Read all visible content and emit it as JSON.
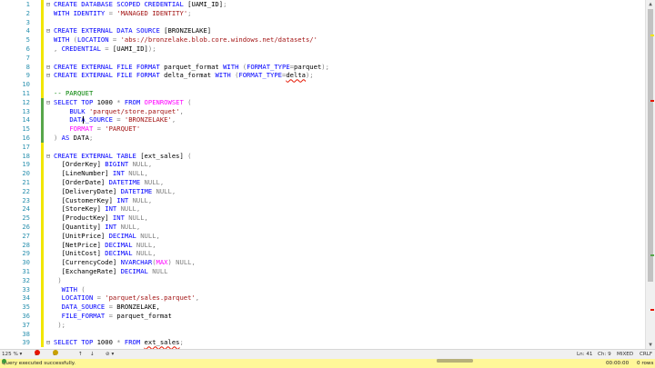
{
  "editor": {
    "lines": [
      {
        "num": "1",
        "tokens": [
          [
            "k",
            "CREATE DATABASE SCOPED CREDENTIAL "
          ],
          [
            "",
            "[UAMI_ID]"
          ],
          [
            "g",
            ";"
          ]
        ]
      },
      {
        "num": "2",
        "tokens": [
          [
            "k",
            "WITH IDENTITY "
          ],
          [
            "g",
            "= "
          ],
          [
            "s",
            "'MANAGED IDENTITY'"
          ],
          [
            "g",
            ";"
          ]
        ]
      },
      {
        "num": "3",
        "tokens": []
      },
      {
        "num": "4",
        "tokens": [
          [
            "k",
            "CREATE EXTERNAL DATA SOURCE "
          ],
          [
            "",
            "[BRONZELAKE]"
          ]
        ]
      },
      {
        "num": "5",
        "tokens": [
          [
            "k",
            "WITH "
          ],
          [
            "g",
            "("
          ],
          [
            "k",
            "LOCATION "
          ],
          [
            "g",
            "= "
          ],
          [
            "s",
            "'abs://bronzelake.blob.core.windows.net/datasets/'"
          ]
        ]
      },
      {
        "num": "6",
        "tokens": [
          [
            "g",
            ", "
          ],
          [
            "k",
            "CREDENTIAL "
          ],
          [
            "g",
            "= "
          ],
          [
            "",
            "[UAMI_ID]"
          ],
          [
            "g",
            ");"
          ]
        ]
      },
      {
        "num": "7",
        "tokens": []
      },
      {
        "num": "8",
        "tokens": [
          [
            "k",
            "CREATE EXTERNAL FILE FORMAT "
          ],
          [
            "",
            "parquet_format "
          ],
          [
            "k",
            "WITH "
          ],
          [
            "g",
            "("
          ],
          [
            "k",
            "FORMAT_TYPE"
          ],
          [
            "g",
            "="
          ],
          [
            "",
            "parquet"
          ],
          [
            "g",
            ");"
          ]
        ]
      },
      {
        "num": "9",
        "tokens": [
          [
            "k",
            "CREATE EXTERNAL FILE FORMAT "
          ],
          [
            "",
            "delta_format "
          ],
          [
            "k",
            "WITH "
          ],
          [
            "g",
            "("
          ],
          [
            "k",
            "FORMAT_TYPE"
          ],
          [
            "g",
            "="
          ],
          [
            "err",
            "delta"
          ],
          [
            "g",
            ");"
          ]
        ]
      },
      {
        "num": "10",
        "tokens": []
      },
      {
        "num": "11",
        "tokens": [
          [
            "c",
            "-- PARQUET"
          ]
        ]
      },
      {
        "num": "12",
        "tokens": [
          [
            "k",
            "SELECT TOP "
          ],
          [
            "",
            "1000 "
          ],
          [
            "g",
            "* "
          ],
          [
            "k",
            "FROM "
          ],
          [
            "f",
            "OPENROWSET "
          ],
          [
            "g",
            "("
          ]
        ]
      },
      {
        "num": "13",
        "tokens": [
          [
            "",
            "    "
          ],
          [
            "k",
            "BULK "
          ],
          [
            "s",
            "'parquet/store.parquet'"
          ],
          [
            "g",
            ","
          ]
        ]
      },
      {
        "num": "14",
        "tokens": [
          [
            "",
            "    "
          ],
          [
            "k",
            "DATA_SOURCE "
          ],
          [
            "g",
            "= "
          ],
          [
            "s",
            "'BRONZELAKE'"
          ],
          [
            "g",
            ","
          ]
        ]
      },
      {
        "num": "15",
        "tokens": [
          [
            "",
            "    "
          ],
          [
            "f",
            "FORMAT "
          ],
          [
            "g",
            "= "
          ],
          [
            "s",
            "'PARQUET'"
          ]
        ]
      },
      {
        "num": "16",
        "tokens": [
          [
            "g",
            ") "
          ],
          [
            "k",
            "AS "
          ],
          [
            "",
            "DATA"
          ],
          [
            "g",
            ";"
          ]
        ]
      },
      {
        "num": "17",
        "tokens": []
      },
      {
        "num": "18",
        "tokens": [
          [
            "k",
            "CREATE EXTERNAL TABLE "
          ],
          [
            "",
            "[ext_sales] "
          ],
          [
            "g",
            "("
          ]
        ]
      },
      {
        "num": "19",
        "tokens": [
          [
            "",
            "  [OrderKey] "
          ],
          [
            "k",
            "BIGINT "
          ],
          [
            "g",
            "NULL,"
          ]
        ]
      },
      {
        "num": "20",
        "tokens": [
          [
            "",
            "  [LineNumber] "
          ],
          [
            "k",
            "INT "
          ],
          [
            "g",
            "NULL,"
          ]
        ]
      },
      {
        "num": "21",
        "tokens": [
          [
            "",
            "  [OrderDate] "
          ],
          [
            "k",
            "DATETIME "
          ],
          [
            "g",
            "NULL,"
          ]
        ]
      },
      {
        "num": "22",
        "tokens": [
          [
            "",
            "  [DeliveryDate] "
          ],
          [
            "k",
            "DATETIME "
          ],
          [
            "g",
            "NULL,"
          ]
        ]
      },
      {
        "num": "23",
        "tokens": [
          [
            "",
            "  [CustomerKey] "
          ],
          [
            "k",
            "INT "
          ],
          [
            "g",
            "NULL,"
          ]
        ]
      },
      {
        "num": "24",
        "tokens": [
          [
            "",
            "  [StoreKey] "
          ],
          [
            "k",
            "INT "
          ],
          [
            "g",
            "NULL,"
          ]
        ]
      },
      {
        "num": "25",
        "tokens": [
          [
            "",
            "  [ProductKey] "
          ],
          [
            "k",
            "INT "
          ],
          [
            "g",
            "NULL,"
          ]
        ]
      },
      {
        "num": "26",
        "tokens": [
          [
            "",
            "  [Quantity] "
          ],
          [
            "k",
            "INT "
          ],
          [
            "g",
            "NULL,"
          ]
        ]
      },
      {
        "num": "27",
        "tokens": [
          [
            "",
            "  [UnitPrice] "
          ],
          [
            "k",
            "DECIMAL "
          ],
          [
            "g",
            "NULL,"
          ]
        ]
      },
      {
        "num": "28",
        "tokens": [
          [
            "",
            "  [NetPrice] "
          ],
          [
            "k",
            "DECIMAL "
          ],
          [
            "g",
            "NULL,"
          ]
        ]
      },
      {
        "num": "29",
        "tokens": [
          [
            "",
            "  [UnitCost] "
          ],
          [
            "k",
            "DECIMAL "
          ],
          [
            "g",
            "NULL,"
          ]
        ]
      },
      {
        "num": "30",
        "tokens": [
          [
            "",
            "  [CurrencyCode] "
          ],
          [
            "k",
            "NVARCHAR"
          ],
          [
            "g",
            "("
          ],
          [
            "f",
            "MAX"
          ],
          [
            "g",
            ") NULL,"
          ]
        ]
      },
      {
        "num": "31",
        "tokens": [
          [
            "",
            "  [ExchangeRate] "
          ],
          [
            "k",
            "DECIMAL "
          ],
          [
            "g",
            "NULL"
          ]
        ]
      },
      {
        "num": "32",
        "tokens": [
          [
            "g",
            " )"
          ]
        ]
      },
      {
        "num": "33",
        "tokens": [
          [
            "",
            "  "
          ],
          [
            "k",
            "WITH "
          ],
          [
            "g",
            "("
          ]
        ]
      },
      {
        "num": "34",
        "tokens": [
          [
            "",
            "  "
          ],
          [
            "k",
            "LOCATION "
          ],
          [
            "g",
            "= "
          ],
          [
            "s",
            "'parquet/sales.parquet'"
          ],
          [
            "g",
            ","
          ]
        ]
      },
      {
        "num": "35",
        "tokens": [
          [
            "",
            "  "
          ],
          [
            "k",
            "DATA_SOURCE "
          ],
          [
            "g",
            "= "
          ],
          [
            "",
            "BRONZELAKE,"
          ]
        ]
      },
      {
        "num": "36",
        "tokens": [
          [
            "",
            "  "
          ],
          [
            "k",
            "FILE_FORMAT "
          ],
          [
            "g",
            "= "
          ],
          [
            "",
            "parquet_format"
          ]
        ]
      },
      {
        "num": "37",
        "tokens": [
          [
            "g",
            " );"
          ]
        ]
      },
      {
        "num": "38",
        "tokens": []
      },
      {
        "num": "39",
        "tokens": [
          [
            "k",
            "SELECT TOP "
          ],
          [
            "",
            "1000 "
          ],
          [
            "g",
            "* "
          ],
          [
            "k",
            "FROM "
          ],
          [
            "err",
            "ext_sales"
          ],
          [
            "g",
            ";"
          ]
        ]
      }
    ]
  },
  "infobar": {
    "zoom": "125 %",
    "errors": "3",
    "warnings": "0",
    "line": "Ln: 41",
    "col": "Ch: 9",
    "mode": "MIXED",
    "eol": "CRLF"
  },
  "statusbar": {
    "message": "Query executed successfully.",
    "elapsed": "00:00:00",
    "rows": "0 rows"
  },
  "colors": {
    "keyword": "#0000ff",
    "string": "#a31515",
    "comment": "#008000",
    "function": "#ff00ff",
    "status_bg": "#fff799",
    "error": "#e51400"
  }
}
